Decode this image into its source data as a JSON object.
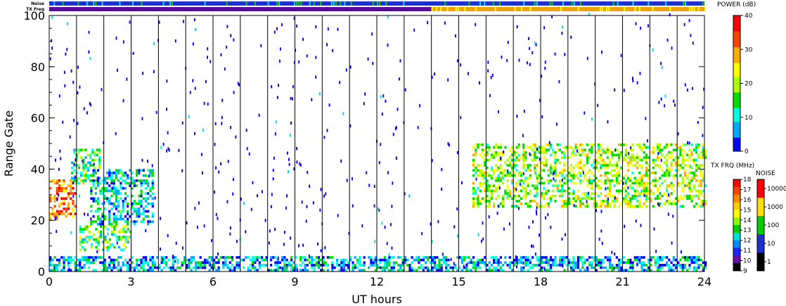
{
  "chart_data": {
    "type": "heatmap",
    "title": "",
    "xlabel": "UT hours",
    "ylabel": "Range Gate",
    "xlim": [
      0,
      24
    ],
    "ylim": [
      0,
      100
    ],
    "x_ticks": [
      0,
      3,
      6,
      9,
      12,
      15,
      18,
      21,
      24
    ],
    "y_ticks": [
      0,
      20,
      40,
      60,
      80,
      100
    ],
    "grid_vertical_hours": [
      1,
      2,
      3,
      4,
      5,
      6,
      7,
      8,
      9,
      10,
      11,
      12,
      13,
      14,
      15,
      16,
      17,
      18,
      19,
      20,
      21,
      22,
      23
    ],
    "top_strips": [
      {
        "label": "Noise",
        "segments": [
          {
            "from": 0,
            "to": 24,
            "color": "#1f2fd6"
          }
        ]
      },
      {
        "label": "TX Freq",
        "segments": [
          {
            "from": 0,
            "to": 14,
            "color": "#5a0a9a"
          },
          {
            "from": 14,
            "to": 24,
            "color": "#f0a000"
          }
        ]
      }
    ],
    "power_colorbar": {
      "title": "POWER (dB)",
      "ticks": [
        "40",
        "30",
        "20",
        "10",
        "0"
      ],
      "stops": [
        "#0000ff",
        "#00aaff",
        "#00ffdd",
        "#00dd00",
        "#aaff00",
        "#ffff00",
        "#ffaa00",
        "#ff4400",
        "#ff0000"
      ]
    },
    "txfrq_colorbar": {
      "title": "TX FRQ (MHz)",
      "ticks": [
        "18",
        "17",
        "16",
        "15",
        "14",
        "13",
        "12",
        "11",
        "10",
        "9"
      ],
      "colors": [
        "#ff0000",
        "#ff4400",
        "#ff8800",
        "#ffcc00",
        "#ffff00",
        "#88ff00",
        "#00cc00",
        "#00dddd",
        "#0088ff",
        "#2222ff",
        "#6a0aaa",
        "#000000"
      ]
    },
    "noise_colorbar": {
      "title": "NOISE",
      "ticks": [
        "10000",
        "1000",
        "100",
        "10",
        "1"
      ],
      "colors": [
        "#ff0000",
        "#ffdd00",
        "#00cc00",
        "#1f2fd6",
        "#000000"
      ]
    },
    "regions": [
      {
        "name": "early-echo-band",
        "x": [
          0.0,
          1.0
        ],
        "y": [
          20,
          36
        ],
        "power": 32
      },
      {
        "name": "early-echo-upper",
        "x": [
          0.8,
          1.8
        ],
        "y": [
          34,
          48
        ],
        "power": 14
      },
      {
        "name": "descending-echo",
        "x": [
          1.5,
          3.8
        ],
        "y": [
          18,
          40
        ],
        "power": 10
      },
      {
        "name": "low-band-echo",
        "x": [
          1.1,
          3.0
        ],
        "y": [
          8,
          18
        ],
        "power": 16
      },
      {
        "name": "ground-echo-band",
        "x": [
          0.0,
          24.0
        ],
        "y": [
          0,
          6
        ],
        "power": 8
      },
      {
        "name": "afternoon-echo-band",
        "x": [
          15.5,
          24.0
        ],
        "y": [
          25,
          50
        ],
        "power": 20
      }
    ]
  }
}
